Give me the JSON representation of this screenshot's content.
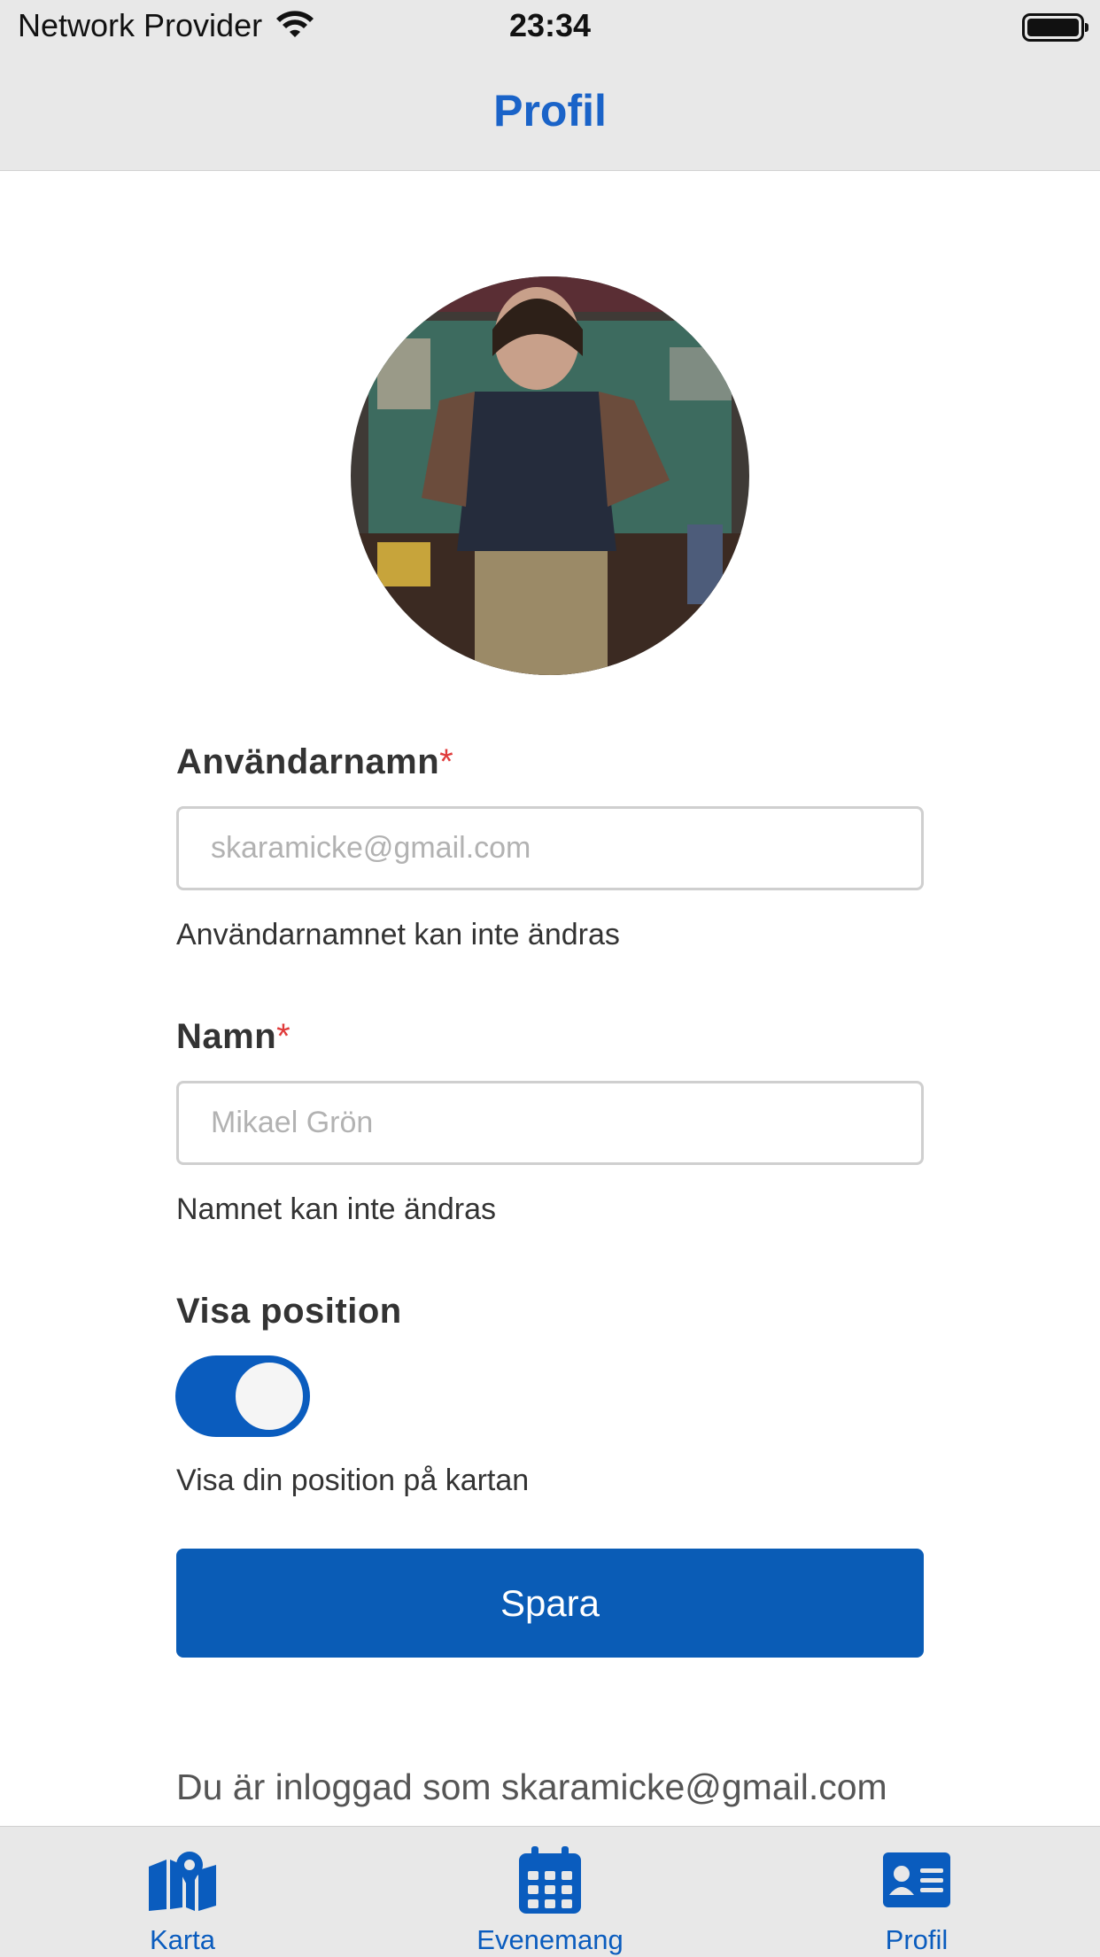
{
  "status_bar": {
    "carrier": "Network Provider",
    "time": "23:34"
  },
  "header": {
    "title": "Profil"
  },
  "profile": {
    "avatar_alt": "profile photo"
  },
  "form": {
    "username": {
      "label": "Användarnamn",
      "required_mark": "*",
      "value": "skaramicke@gmail.com",
      "hint": "Användarnamnet kan inte ändras"
    },
    "name": {
      "label": "Namn",
      "required_mark": "*",
      "value": "Mikael Grön",
      "hint": "Namnet kan inte ändras"
    },
    "show_position": {
      "label": "Visa position",
      "enabled": true,
      "hint": "Visa din position på kartan"
    },
    "save_label": "Spara"
  },
  "footer_text": "Du är inloggad som skaramicke@gmail.com",
  "tabbar": {
    "items": [
      {
        "label": "Karta",
        "icon": "map-icon"
      },
      {
        "label": "Evenemang",
        "icon": "calendar-icon"
      },
      {
        "label": "Profil",
        "icon": "profile-card-icon"
      }
    ]
  },
  "colors": {
    "accent": "#0a5cbe",
    "required": "#e03b3b"
  }
}
